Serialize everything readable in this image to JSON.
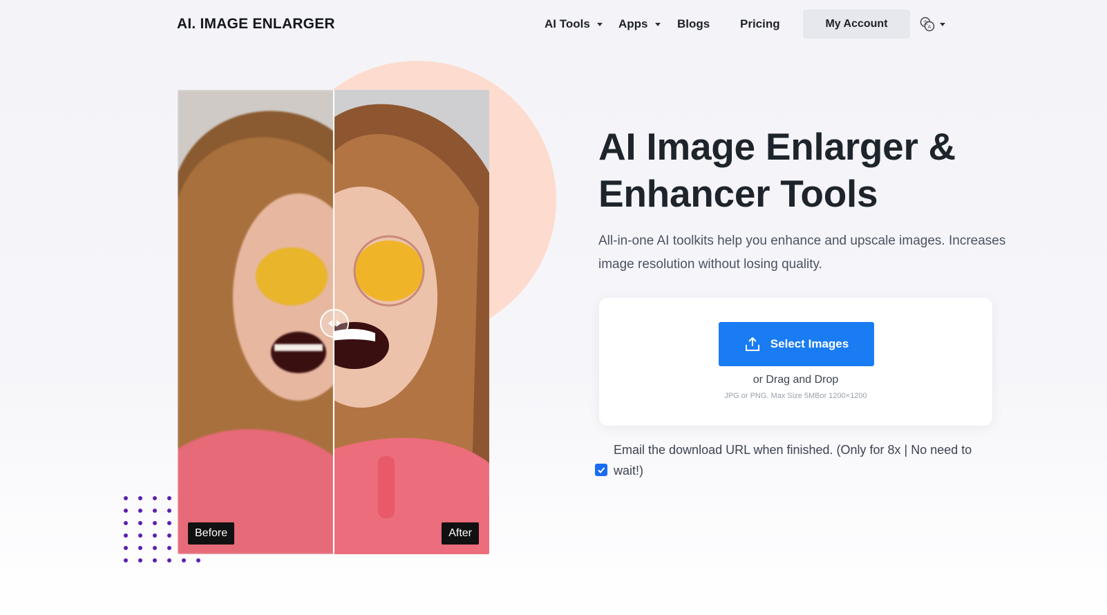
{
  "header": {
    "logo": "AI. IMAGE ENLARGER",
    "nav": [
      {
        "label": "AI Tools",
        "dropdown": true
      },
      {
        "label": "Apps",
        "dropdown": true
      },
      {
        "label": "Blogs",
        "dropdown": false
      },
      {
        "label": "Pricing",
        "dropdown": false
      }
    ],
    "account_label": "My Account",
    "language_icon": "translate-icon"
  },
  "hero": {
    "title": "AI Image Enlarger & Enhancer Tools",
    "subtitle": "All-in-one AI toolkits help you enhance and upscale images. Increases image resolution without losing quality.",
    "compare": {
      "before_label": "Before",
      "after_label": "After",
      "split_position": 0.5
    }
  },
  "upload": {
    "button_label": "Select Images",
    "button_icon": "upload-icon",
    "drag_text": "or Drag and Drop",
    "limits_text": "JPG or PNG. Max Size 5MBor 1200×1200"
  },
  "email_option": {
    "checked": true,
    "text": "Email the download URL when finished. (Only for 8x | No need to wait!)"
  },
  "colors": {
    "accent": "#1a7cf3",
    "circle": "#fddccf",
    "dots": "#5c1fb0"
  }
}
